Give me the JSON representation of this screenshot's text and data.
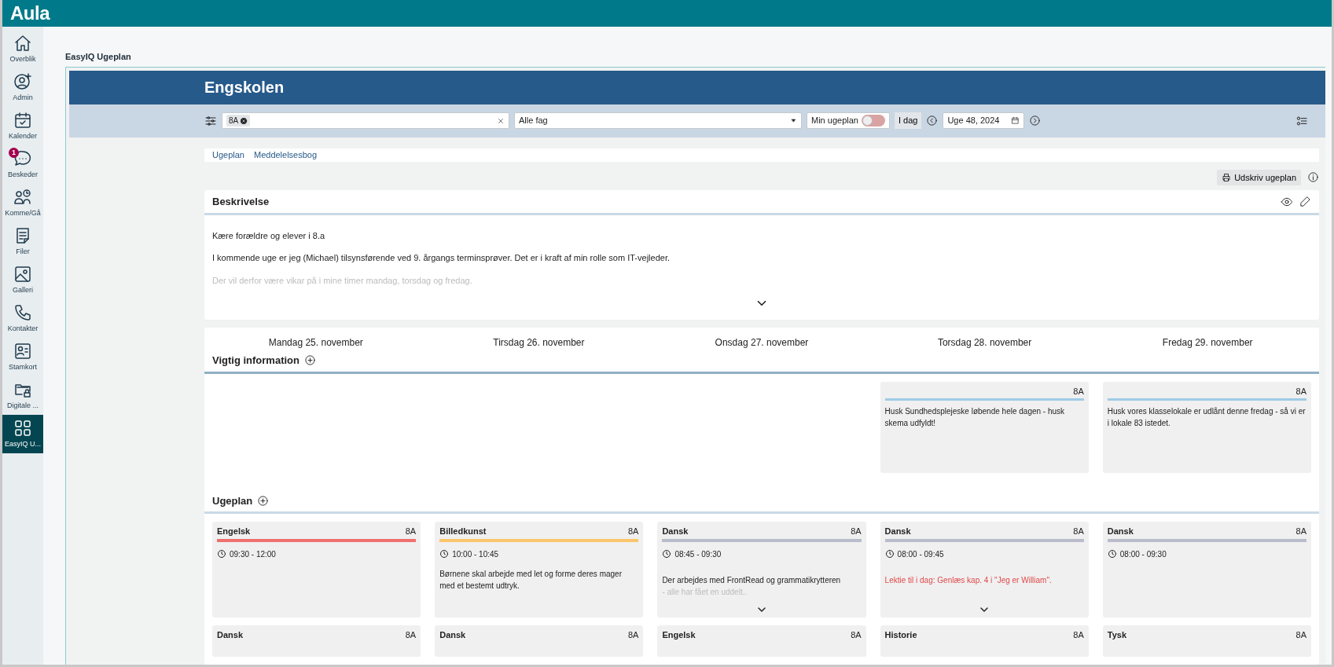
{
  "app": {
    "logo": "Aula"
  },
  "sidebar": {
    "items": [
      {
        "label": "Overblik",
        "selected": false
      },
      {
        "label": "Admin",
        "selected": false
      },
      {
        "label": "Kalender",
        "selected": false
      },
      {
        "label": "Beskeder",
        "badge": "1",
        "selected": false
      },
      {
        "label": "Komme/Gå",
        "selected": false
      },
      {
        "label": "Filer",
        "selected": false
      },
      {
        "label": "Galleri",
        "selected": false
      },
      {
        "label": "Kontakter",
        "selected": false
      },
      {
        "label": "Stamkort",
        "selected": false
      },
      {
        "label": "Digitale ...",
        "selected": false
      },
      {
        "label": "EasyIQ U...",
        "selected": true
      }
    ]
  },
  "page_title": "EasyIQ Ugeplan",
  "school": "Engskolen",
  "toolbar": {
    "class_tag": "8A",
    "subject_select": "Alle fag",
    "toggle": {
      "label": "Min ugeplan",
      "on": false
    },
    "today_button": "I dag",
    "week": "Uge 48, 2024"
  },
  "tabs": [
    {
      "label": "Ugeplan",
      "selected": false
    },
    {
      "label": "Meddelelsesbog",
      "selected": false
    }
  ],
  "print_button": "Udskriv ugeplan",
  "description": {
    "title": "Beskrivelse",
    "paragraphs": [
      {
        "text": "Kære forældre og elever i 8.a",
        "kind": "normal"
      },
      {
        "text": "I kommende uge er jeg (Michael) tilsynsførende ved 9. årgangs terminsprøver. Det er i kraft af min rolle som IT-vejleder.",
        "kind": "normal"
      },
      {
        "text": "Der vil derfor være vikar på i mine timer mandag, torsdag og fredag.",
        "kind": "faded"
      }
    ],
    "expandable": true
  },
  "days": [
    "Mandag 25. november",
    "Tirsdag 26. november",
    "Onsdag 27. november",
    "Torsdag 28. november",
    "Fredag 29. november"
  ],
  "important": {
    "title": "Vigtig information",
    "columns": [
      {
        "kind": "empty"
      },
      {
        "kind": "empty"
      },
      {
        "kind": "empty"
      },
      {
        "kind": "note",
        "class": "8A",
        "text": "Husk Sundhedsplejeske løbende hele dagen - husk skema udfyldt!"
      },
      {
        "kind": "note",
        "class": "8A",
        "text": "Husk vores klasselokale er udlånt denne fredag - så vi er i lokale 83 istedet."
      }
    ]
  },
  "weekplan": {
    "title": "Ugeplan",
    "lessons": [
      {
        "subject": "Engelsk",
        "class": "8A",
        "color": "#f07070",
        "time": "09:30 - 12:00",
        "expandable": false
      },
      {
        "subject": "Billedkunst",
        "class": "8A",
        "color": "#fbc56b",
        "time": "10:00 - 10:45",
        "lines": [
          {
            "text": "Børnene skal arbejde med let og forme deres mager med et bestemt udtryk.",
            "kind": "normal"
          }
        ],
        "expandable": false
      },
      {
        "subject": "Dansk",
        "class": "8A",
        "color": "#b8bccb",
        "time": "08:45 - 09:30",
        "lines": [
          {
            "text": "Der arbejdes med FrontRead og grammatikrytteren",
            "kind": "normal"
          },
          {
            "text": "- alle har fået en uddelt..",
            "kind": "faded"
          }
        ],
        "expandable": true
      },
      {
        "subject": "Dansk",
        "class": "8A",
        "color": "#b8bccb",
        "time": "08:00 - 09:45",
        "lines": [
          {
            "text": "Lektie til i dag: Genlæs kap. 4 i \"Jeg er William\".",
            "kind": "homework"
          }
        ],
        "expandable": true
      },
      {
        "subject": "Dansk",
        "class": "8A",
        "color": "#b8bccb",
        "time": "08:00 - 09:30",
        "expandable": false
      },
      {
        "subject": "Dansk",
        "class": "8A"
      },
      {
        "subject": "Dansk",
        "class": "8A"
      },
      {
        "subject": "Engelsk",
        "class": "8A"
      },
      {
        "subject": "Historie",
        "class": "8A"
      },
      {
        "subject": "Tysk",
        "class": "8A"
      }
    ]
  }
}
